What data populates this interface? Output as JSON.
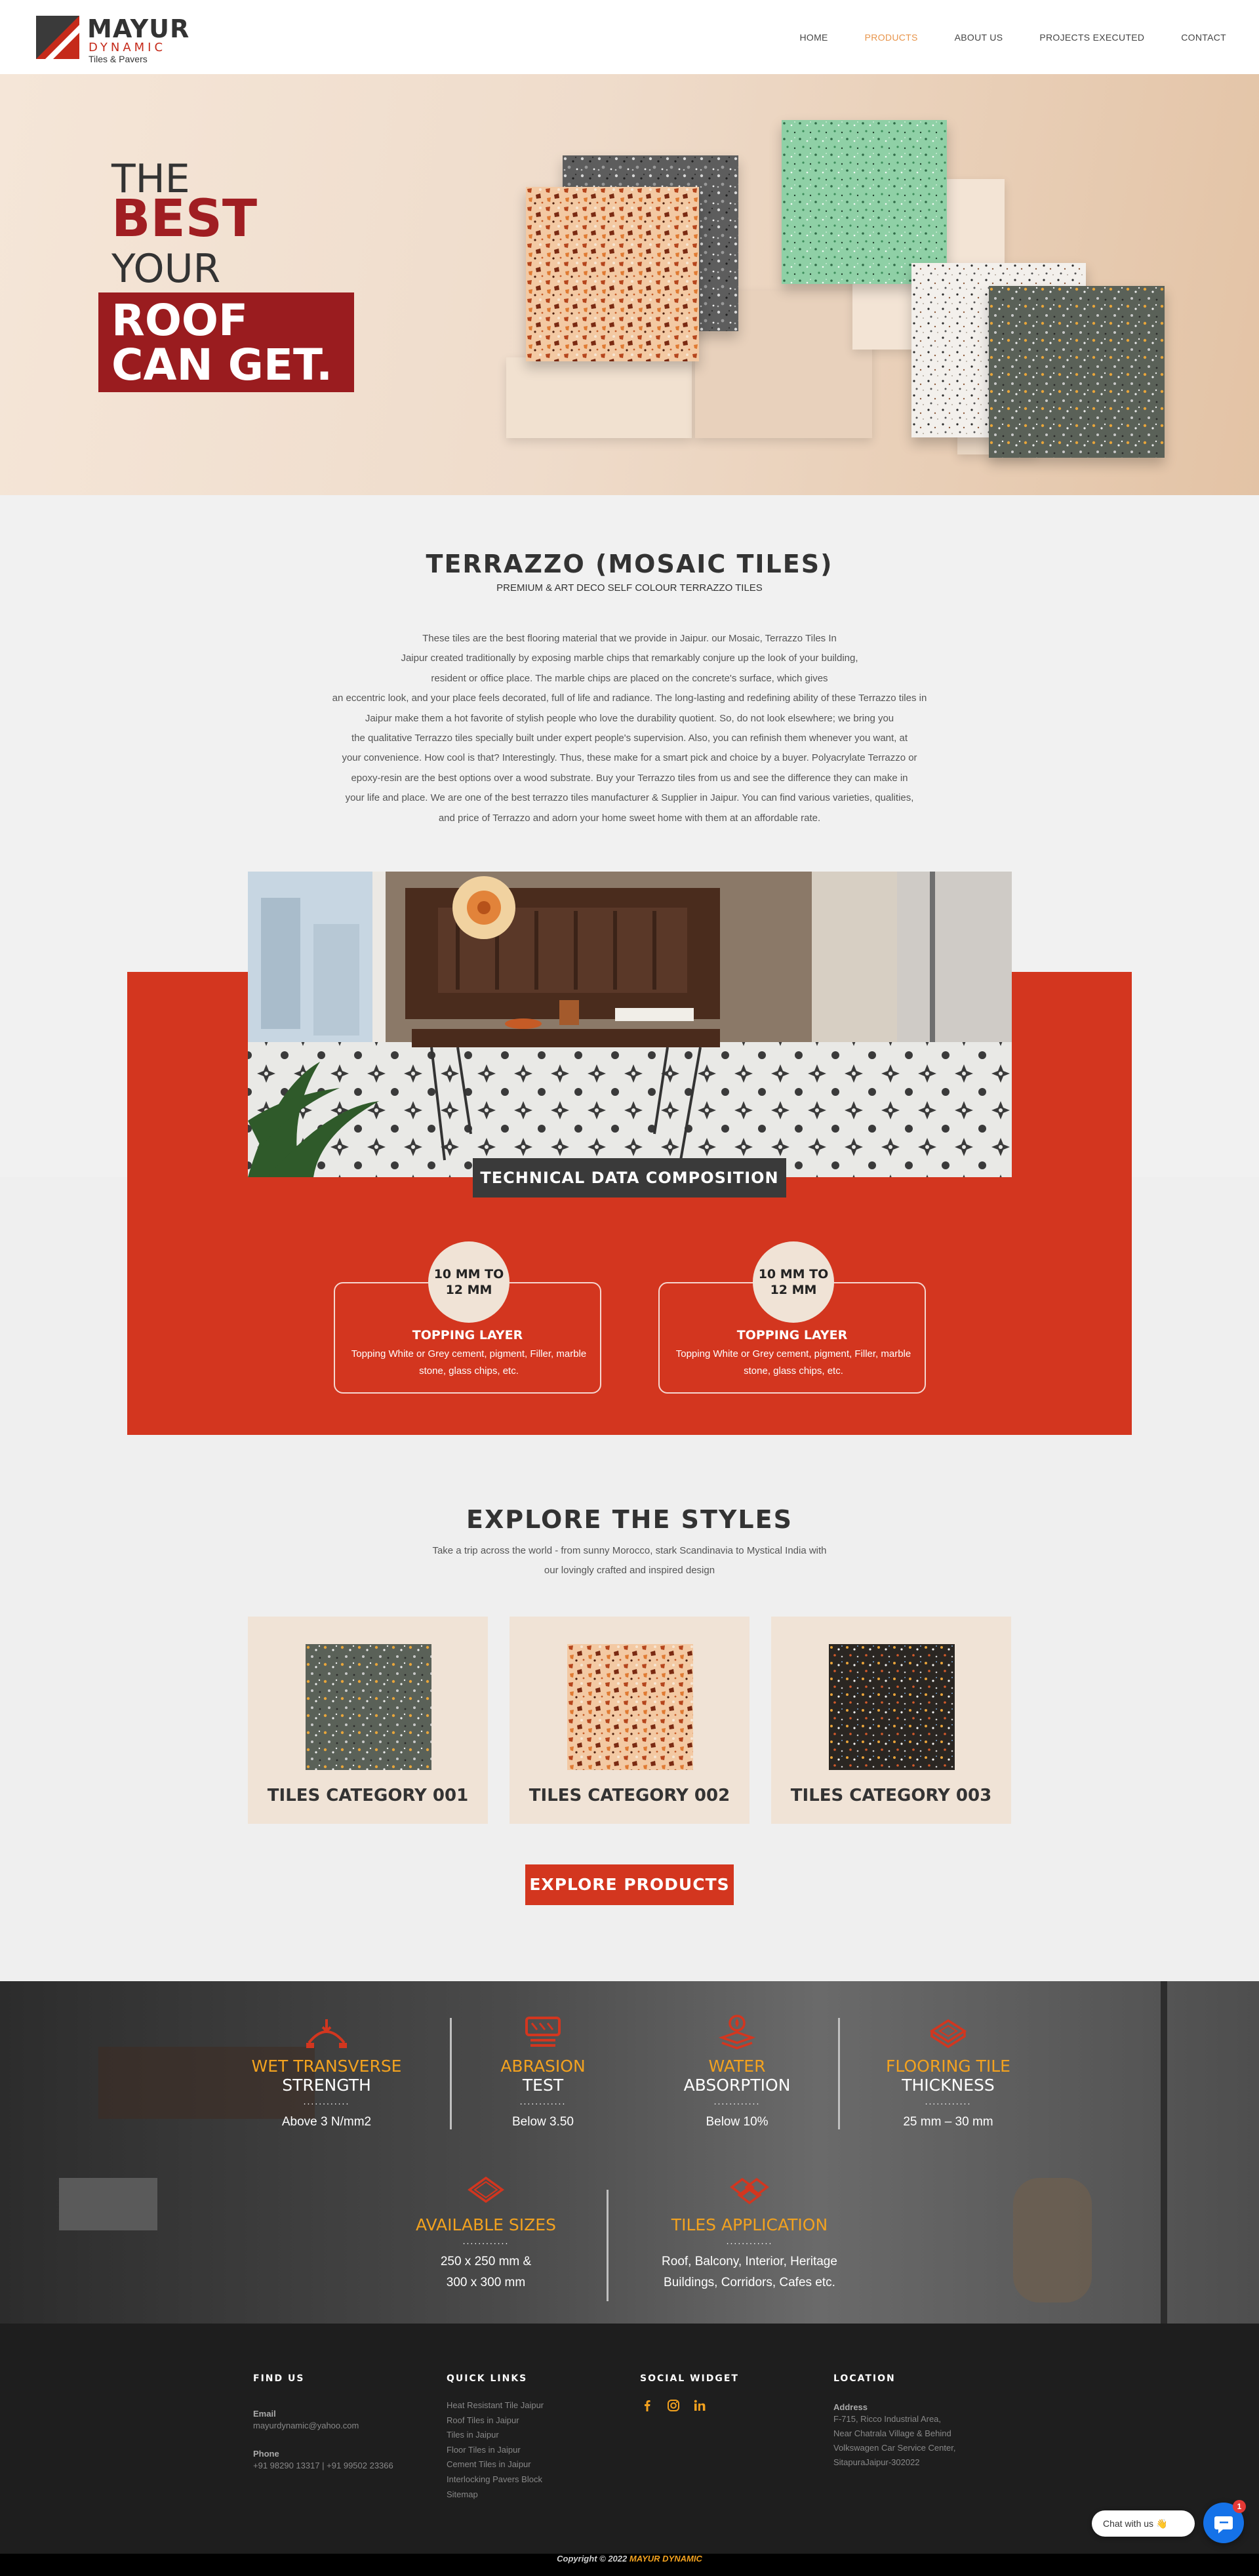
{
  "brand": {
    "name": "MAYUR",
    "sub": "DYNAMIC",
    "tagline": "Tiles & Pavers"
  },
  "nav": {
    "items": [
      {
        "label": "HOME"
      },
      {
        "label": "PRODUCTS"
      },
      {
        "label": "ABOUT US"
      },
      {
        "label": "PROJECTS EXECUTED"
      },
      {
        "label": "CONTACT"
      }
    ],
    "active": "PRODUCTS",
    "accent": "#e8944a"
  },
  "hero": {
    "line1": "THE",
    "line2": "BEST",
    "line3": "YOUR",
    "line4": "ROOF",
    "line5": "CAN GET."
  },
  "intro": {
    "title": "TERRAZZO (MOSAIC TILES)",
    "subtitle": "PREMIUM & ART DECO SELF COLOUR TERRAZZO TILES",
    "lines": [
      "These tiles are the best flooring material that we provide in Jaipur. our Mosaic, Terrazzo Tiles In",
      "Jaipur created traditionally by exposing marble chips that remarkably conjure up the look of your building,",
      "resident or office place. The marble chips are placed on the concrete's surface, which gives",
      "an eccentric look, and your place feels decorated, full of life and radiance. The long-lasting and redefining ability of these Terrazzo tiles in",
      "Jaipur make them a hot favorite of stylish people who love the durability quotient. So, do not look elsewhere; we bring you",
      "the qualitative Terrazzo tiles specially built under expert people's supervision. Also, you can refinish them whenever you want, at",
      "your convenience. How cool is that? Interestingly. Thus, these make for a smart pick and choice by a buyer. Polyacrylate Terrazzo or",
      "epoxy-resin are the best options over a wood substrate. Buy your Terrazzo tiles from us and see the difference they can make in",
      "your life and place. We are one of the best terrazzo tiles manufacturer & Supplier in Jaipur. You can find various varieties, qualities,",
      "and price of Terrazzo and adorn your home sweet home with them at an affordable rate."
    ]
  },
  "technical": {
    "title": "TECHNICAL DATA COMPOSITION",
    "cards": [
      {
        "thickness_line1": "10 MM TO",
        "thickness_line2": "12 MM",
        "title": "TOPPING LAYER",
        "text": "Topping White or Grey cement, pigment, Filler, marble stone, glass chips, etc."
      },
      {
        "thickness_line1": "10 MM TO",
        "thickness_line2": "12 MM",
        "title": "TOPPING LAYER",
        "text": "Topping White or Grey cement, pigment, Filler, marble stone, glass chips, etc."
      }
    ]
  },
  "explore": {
    "title": "EXPLORE THE STYLES",
    "line1": "Take a trip across the world - from sunny Morocco, stark Scandinavia to Mystical India with",
    "line2": "our lovingly crafted and inspired design",
    "categories": [
      {
        "label": "TILES CATEGORY 001"
      },
      {
        "label": "TILES CATEGORY 002"
      },
      {
        "label": "TILES CATEGORY 003"
      }
    ],
    "button": "EXPLORE PRODUCTS"
  },
  "specs": {
    "dots": "............",
    "items": [
      {
        "t1": "WET TRANSVERSE",
        "t2": "STRENGTH",
        "value": "Above 3 N/mm2",
        "icon": "bending-icon"
      },
      {
        "t1": "ABRASION",
        "t2": "TEST",
        "value": "Below 3.50",
        "icon": "abrasion-icon"
      },
      {
        "t1": "WATER",
        "t2": "ABSORPTION",
        "value": "Below 10%",
        "icon": "water-drop-icon"
      },
      {
        "t1": "FLOORING TILE",
        "t2": "THICKNESS",
        "value": "25 mm – 30 mm",
        "icon": "tile-thickness-icon"
      },
      {
        "t1": "AVAILABLE SIZES",
        "t2": "",
        "value1": "250 x 250 mm &",
        "value2": "300 x 300 mm",
        "icon": "tile-size-icon"
      },
      {
        "t1": "TILES APPLICATION",
        "t2": "",
        "value1": "Roof, Balcony, Interior, Heritage",
        "value2": "Buildings, Corridors, Cafes etc.",
        "icon": "tile-stack-icon"
      }
    ]
  },
  "footer": {
    "find_us": {
      "heading": "FIND US",
      "email_label": "Email",
      "email": "mayurdynamic@yahoo.com",
      "phone_label": "Phone",
      "phone": "+91 98290 13317 | +91 99502 23366"
    },
    "quick_links": {
      "heading": "QUICK LINKS",
      "items": [
        "Heat Resistant Tile Jaipur",
        "Roof Tiles in Jaipur",
        "Tiles in Jaipur",
        "Floor Tiles in Jaipur",
        "Cement Tiles in Jaipur",
        "Interlocking Pavers Block",
        "Sitemap"
      ]
    },
    "social": {
      "heading": "SOCIAL WIDGET",
      "icons": [
        "facebook-icon",
        "instagram-icon",
        "linkedin-icon"
      ]
    },
    "location": {
      "heading": "LOCATION",
      "label": "Address",
      "line1": "F-715, Ricco Industrial Area,",
      "line2": "Near Chatrala Village & Behind",
      "line3": "Volkswagen Car Service Center,",
      "line4": "SitapuraJaipur-302022"
    },
    "copyright_prefix": "Copyright © 2022",
    "copyright_brand": "MAYUR DYNAMIC"
  },
  "chat": {
    "label": "Chat with us",
    "emoji": "👋",
    "badge": "1"
  },
  "colors": {
    "brand_red": "#d3361f",
    "dark_red": "#9a1c1f",
    "orange": "#f3a21f"
  }
}
